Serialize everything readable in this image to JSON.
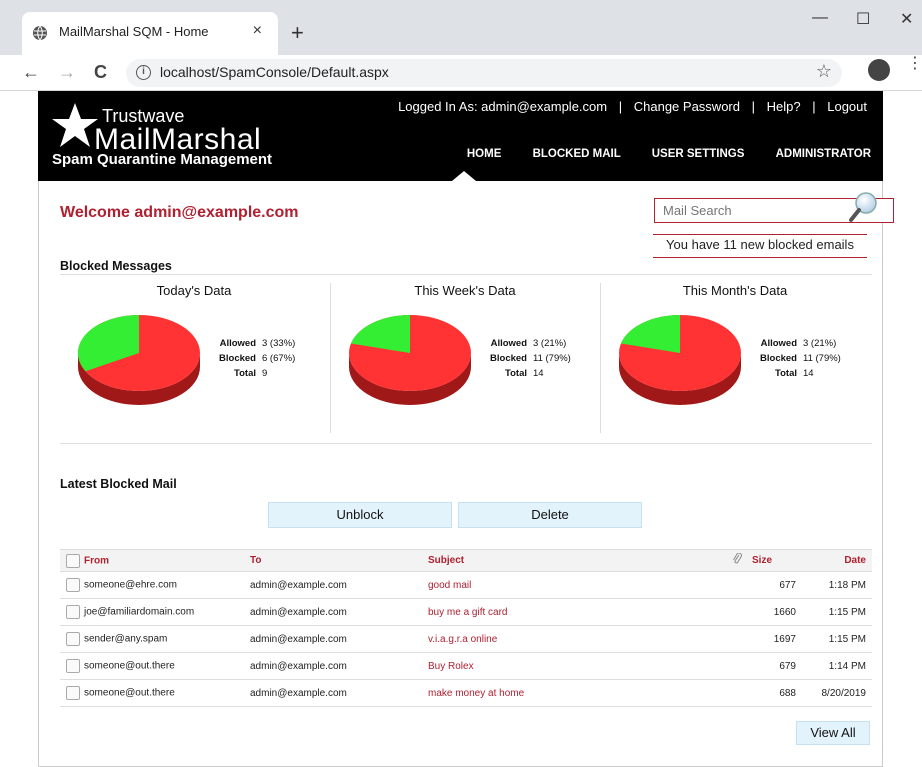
{
  "browser": {
    "tab_title": "MailMarshal SQM - Home",
    "tab_close": "×",
    "new_tab": "+",
    "url": "localhost/SpamConsole/Default.aspx",
    "minimize": "—",
    "maximize": "☐",
    "close": "✕",
    "back": "←",
    "forward": "→",
    "reload": "C",
    "info": "i",
    "bookmark": "☆",
    "menu": "⋮"
  },
  "header": {
    "logo_trustwave": "Trustwave",
    "logo_mailmarshal": "MailMarshal",
    "logo_subtitle": "Spam Quarantine Management",
    "logged_in": "Logged In As: admin@example.com",
    "sep": "|",
    "change_password": "Change Password",
    "help": "Help?",
    "logout": "Logout",
    "nav": [
      "HOME",
      "BLOCKED MAIL",
      "USER SETTINGS",
      "ADMINISTRATOR"
    ]
  },
  "main": {
    "welcome": "Welcome admin@example.com",
    "search_placeholder": "Mail Search",
    "new_blocked": "You have 11 new blocked emails",
    "blocked_messages_title": "Blocked Messages",
    "stats": [
      {
        "title": "Today's Data",
        "allowed_label": "Allowed",
        "allowed": "3 (33%)",
        "blocked_label": "Blocked",
        "blocked": "6 (67%)",
        "total_label": "Total",
        "total": "9",
        "allowed_fraction": 0.33
      },
      {
        "title": "This Week's Data",
        "allowed_label": "Allowed",
        "allowed": "3 (21%)",
        "blocked_label": "Blocked",
        "blocked": "11 (79%)",
        "total_label": "Total",
        "total": "14",
        "allowed_fraction": 0.21
      },
      {
        "title": "This Month's Data",
        "allowed_label": "Allowed",
        "allowed": "3 (21%)",
        "blocked_label": "Blocked",
        "blocked": "11 (79%)",
        "total_label": "Total",
        "total": "14",
        "allowed_fraction": 0.21
      }
    ],
    "latest_title": "Latest Blocked Mail",
    "unblock": "Unblock",
    "delete": "Delete",
    "columns": {
      "from": "From",
      "to": "To",
      "subject": "Subject",
      "size": "Size",
      "date": "Date"
    },
    "rows": [
      {
        "from": "someone@ehre.com",
        "to": "admin@example.com",
        "subject": "good mail",
        "size": "677",
        "date": "1:18 PM"
      },
      {
        "from": "joe@familiardomain.com",
        "to": "admin@example.com",
        "subject": "buy me a gift card",
        "size": "1660",
        "date": "1:15 PM"
      },
      {
        "from": "sender@any.spam",
        "to": "admin@example.com",
        "subject": "v.i.a.g.r.a online",
        "size": "1697",
        "date": "1:15 PM"
      },
      {
        "from": "someone@out.there",
        "to": "admin@example.com",
        "subject": "Buy Rolex",
        "size": "679",
        "date": "1:14 PM"
      },
      {
        "from": "someone@out.there",
        "to": "admin@example.com",
        "subject": "make money at home",
        "size": "688",
        "date": "8/20/2019"
      }
    ],
    "view_all": "View All"
  },
  "colors": {
    "accent": "#b02030",
    "allowed": "#33ee33",
    "blocked": "#ff3333",
    "blocked_shadow": "#a01818"
  }
}
